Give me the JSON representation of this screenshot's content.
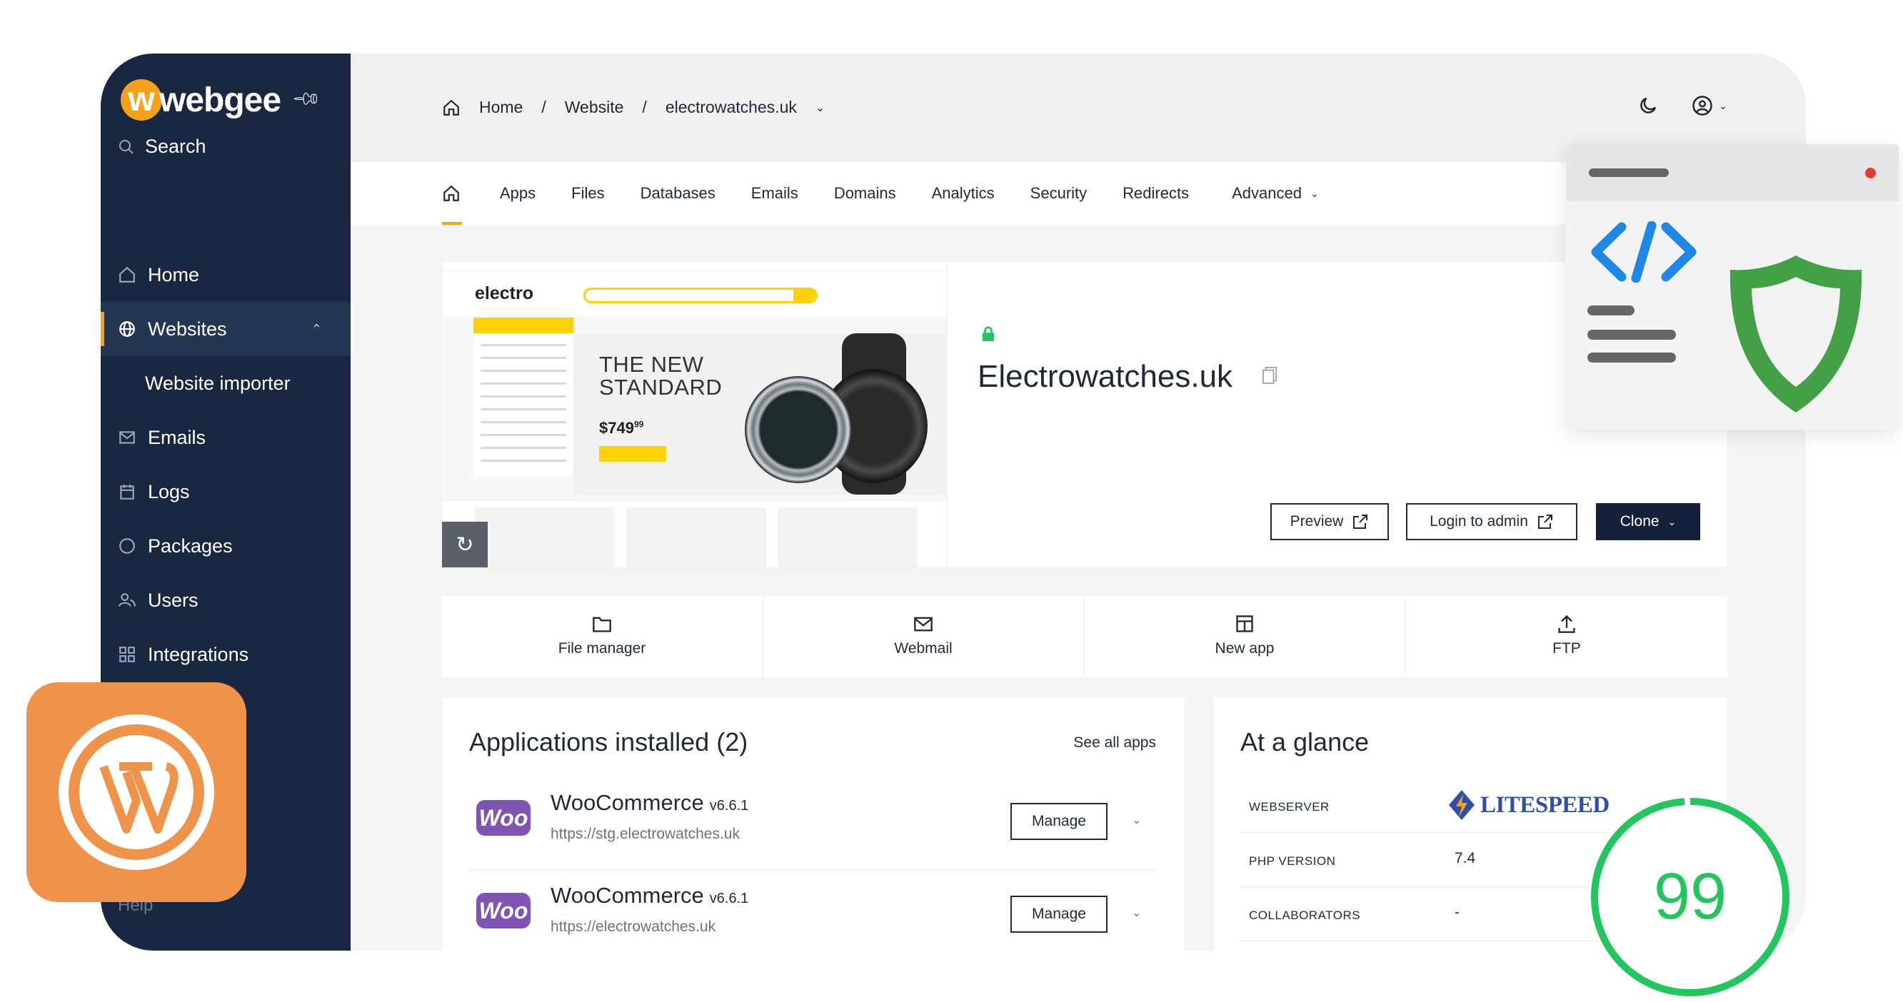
{
  "brand": {
    "name": "webgee",
    "accent": "#f7a11a",
    "sidebar_bg": "#1a2740"
  },
  "sidebar": {
    "search_label": "Search",
    "items": [
      {
        "label": "Home",
        "icon": "home-icon"
      },
      {
        "label": "Websites",
        "icon": "globe-icon",
        "expanded": true
      },
      {
        "label": "Website importer",
        "icon": ""
      },
      {
        "label": "Emails",
        "icon": "mail-icon"
      },
      {
        "label": "Logs",
        "icon": "calendar-icon"
      },
      {
        "label": "Packages",
        "icon": "package-icon"
      },
      {
        "label": "Users",
        "icon": "users-icon"
      },
      {
        "label": "Integrations",
        "icon": "grid-icon"
      }
    ],
    "help_label": "Help"
  },
  "breadcrumb": {
    "home": "Home",
    "section": "Website",
    "current": "electrowatches.uk"
  },
  "tabs": [
    "Apps",
    "Files",
    "Databases",
    "Emails",
    "Domains",
    "Analytics",
    "Security",
    "Redirects",
    "Advanced"
  ],
  "site": {
    "title": "Electrowatches.uk",
    "preview_label": "Preview",
    "login_label": "Login to admin",
    "clone_label": "Clone",
    "screenshot": {
      "brand": "electro",
      "headline_1": "THE NEW",
      "headline_2": "STANDARD",
      "price": "$749",
      "price_cents": "99"
    }
  },
  "quick_actions": [
    {
      "label": "File manager",
      "icon": "folder-icon"
    },
    {
      "label": "Webmail",
      "icon": "mail-icon"
    },
    {
      "label": "New app",
      "icon": "app-icon"
    },
    {
      "label": "FTP",
      "icon": "upload-icon"
    }
  ],
  "apps": {
    "title": "Applications installed (2)",
    "see_all": "See all apps",
    "rows": [
      {
        "logo": "Woo",
        "name": "WooCommerce",
        "version": "v6.6.1",
        "url": "https://stg.electrowatches.uk",
        "action": "Manage"
      },
      {
        "logo": "Woo",
        "name": "WooCommerce",
        "version": "v6.6.1",
        "url": "https://electrowatches.uk",
        "action": "Manage"
      }
    ]
  },
  "glance": {
    "title": "At a glance",
    "rows": [
      {
        "key": "WEBSERVER",
        "value": "LITESPEED"
      },
      {
        "key": "PHP VERSION",
        "value": "7.4"
      },
      {
        "key": "COLLABORATORS",
        "value": "-"
      }
    ]
  },
  "score": {
    "value": "99",
    "fraction": 0.99,
    "color": "#22c55e"
  }
}
